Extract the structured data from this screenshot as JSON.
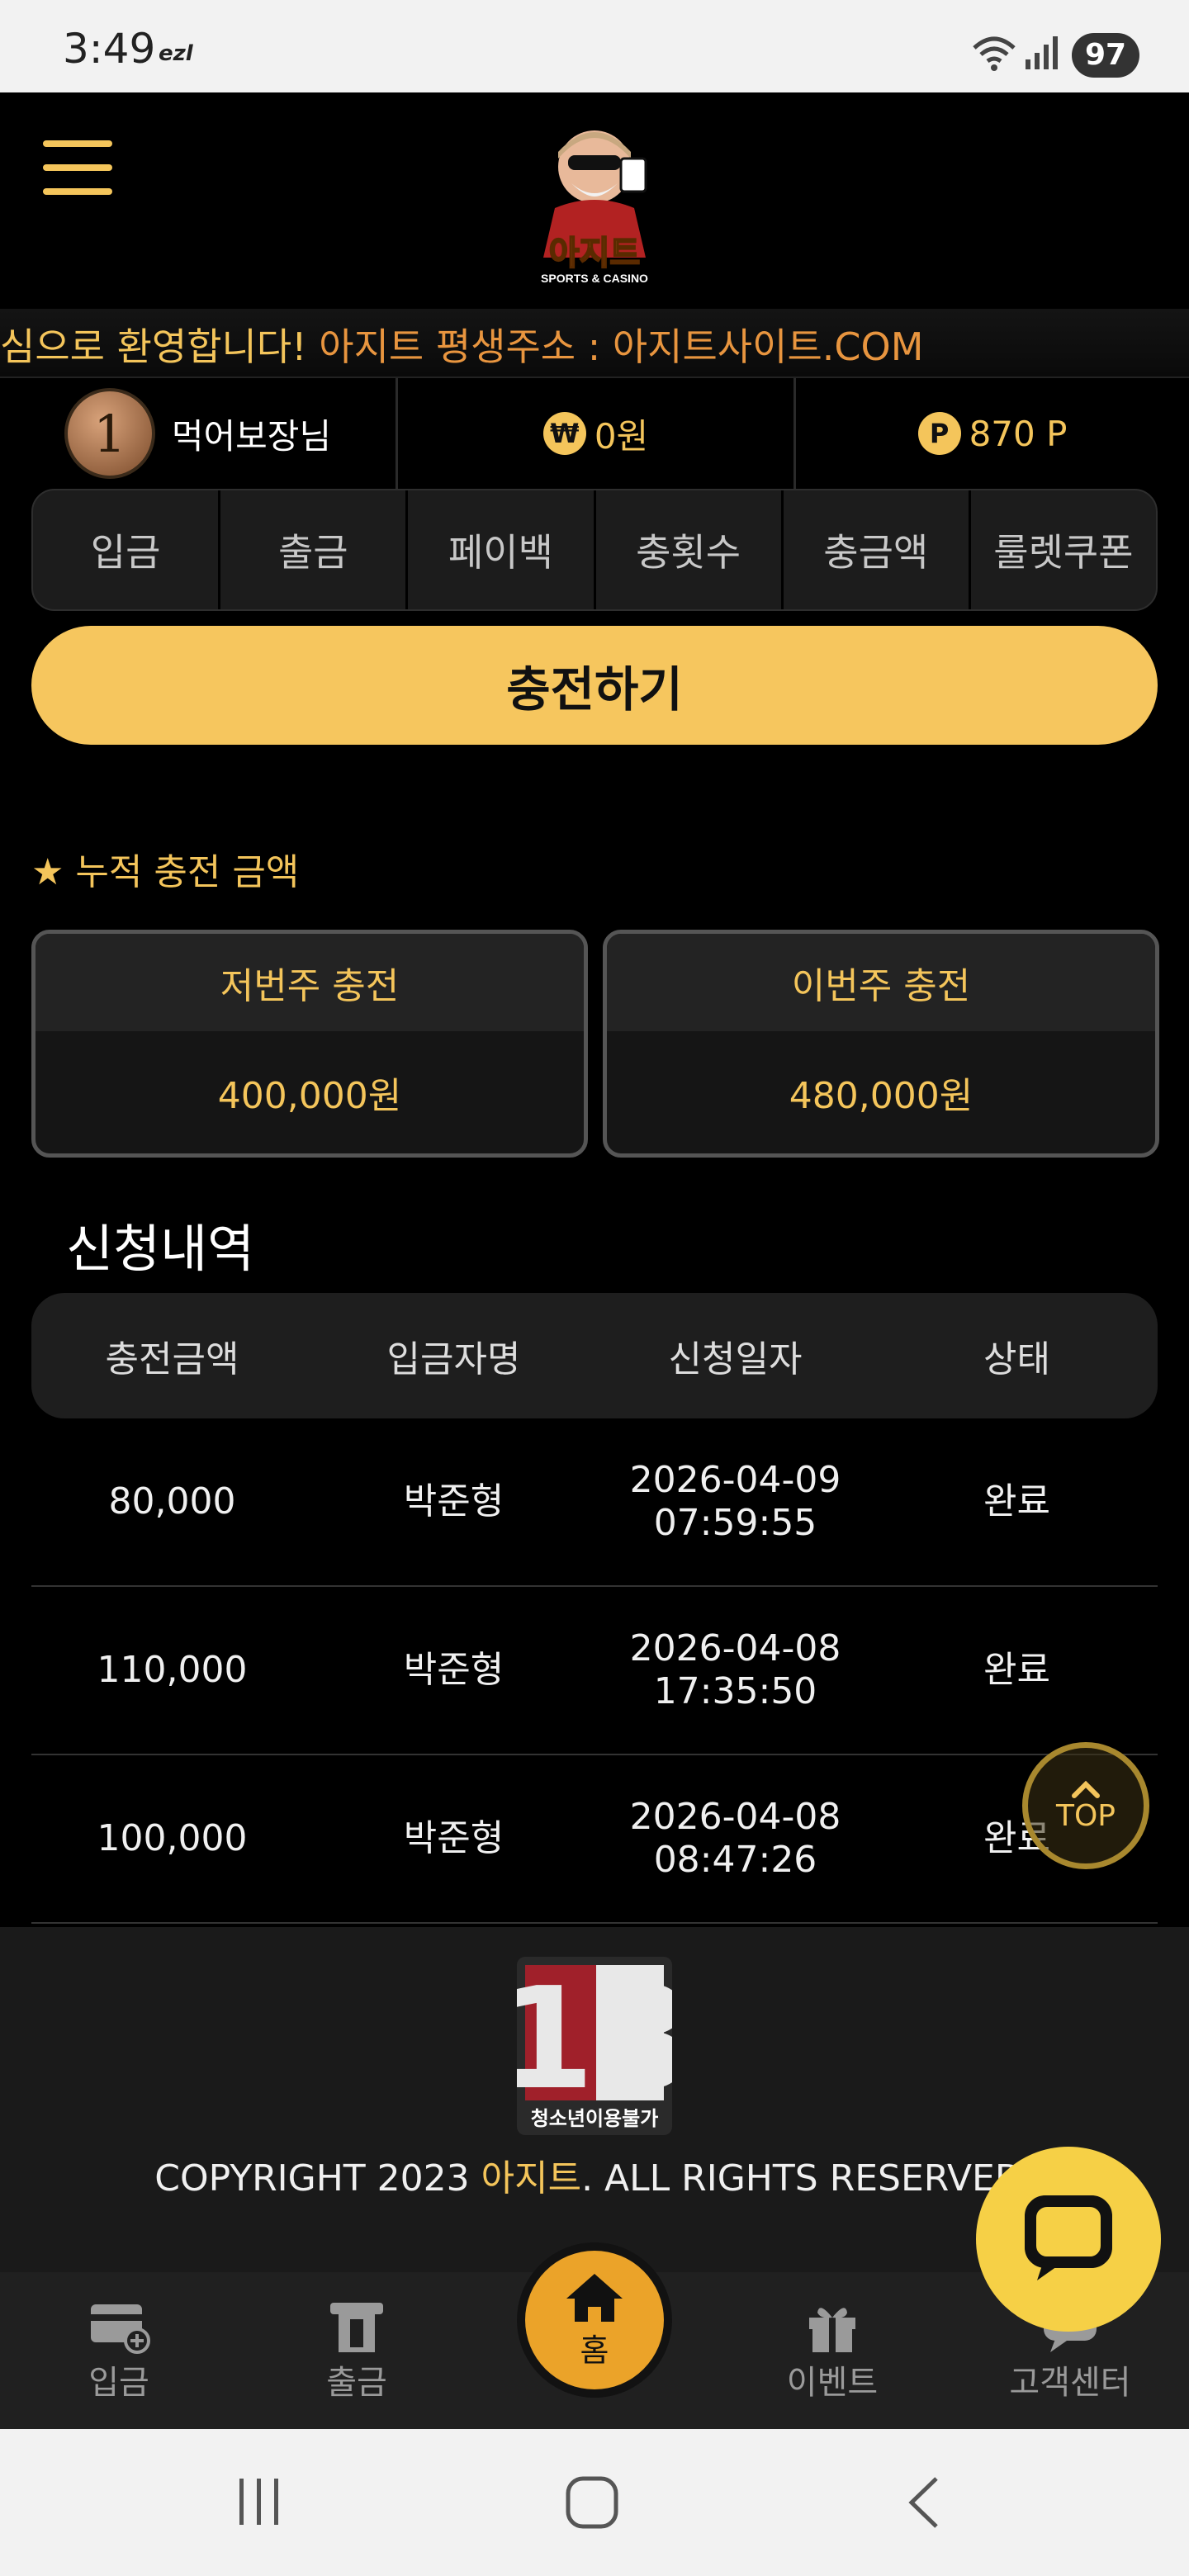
{
  "status_bar": {
    "time": "3:49",
    "carrier": "ezl",
    "battery": "97"
  },
  "marquee": {
    "welcome": "심으로 환영합니다!",
    "address": " 아지트 평생주소 : 아지트사이트.COM"
  },
  "user": {
    "level": "1",
    "name": "먹어보장님",
    "balance": "0원",
    "points": "870 P",
    "won_symbol": "₩",
    "point_symbol": "P"
  },
  "tabs": [
    "입금",
    "출금",
    "페이백",
    "충횟수",
    "충금액",
    "룰렛쿠폰"
  ],
  "charge_button": "충전하기",
  "cumulative": {
    "title": "★ 누적 충전 금액",
    "last_week_label": "저번주 충전",
    "last_week_value": "400,000원",
    "this_week_label": "이번주 충전",
    "this_week_value": "480,000원"
  },
  "requests": {
    "title": "신청내역",
    "headers": [
      "충전금액",
      "입금자명",
      "신청일자",
      "상태"
    ],
    "rows": [
      {
        "amount": "80,000",
        "name": "박준형",
        "date": "2026-04-09",
        "time": "07:59:55",
        "status": "완료"
      },
      {
        "amount": "110,000",
        "name": "박준형",
        "date": "2026-04-08",
        "time": "17:35:50",
        "status": "완료"
      },
      {
        "amount": "100,000",
        "name": "박준형",
        "date": "2026-04-08",
        "time": "08:47:26",
        "status": "완료"
      }
    ]
  },
  "top_button": "TOP",
  "footer": {
    "age_badge_number": "18",
    "age_badge_text": "청소년이용불가",
    "copyright_prefix": "COPYRIGHT 2023 ",
    "copyright_brand": "아지트",
    "copyright_suffix": ". ALL RIGHTS RESERVED."
  },
  "logo": {
    "brand": "아지트",
    "subtitle": "SPORTS & CASINO"
  },
  "bottom_nav": {
    "deposit": "입금",
    "withdraw": "출금",
    "home": "홈",
    "event": "이벤트",
    "support": "고객센터"
  },
  "colors": {
    "accent": "#f4c55b",
    "button": "#f6c65e",
    "home": "#eba329",
    "chat": "#f6d046"
  }
}
